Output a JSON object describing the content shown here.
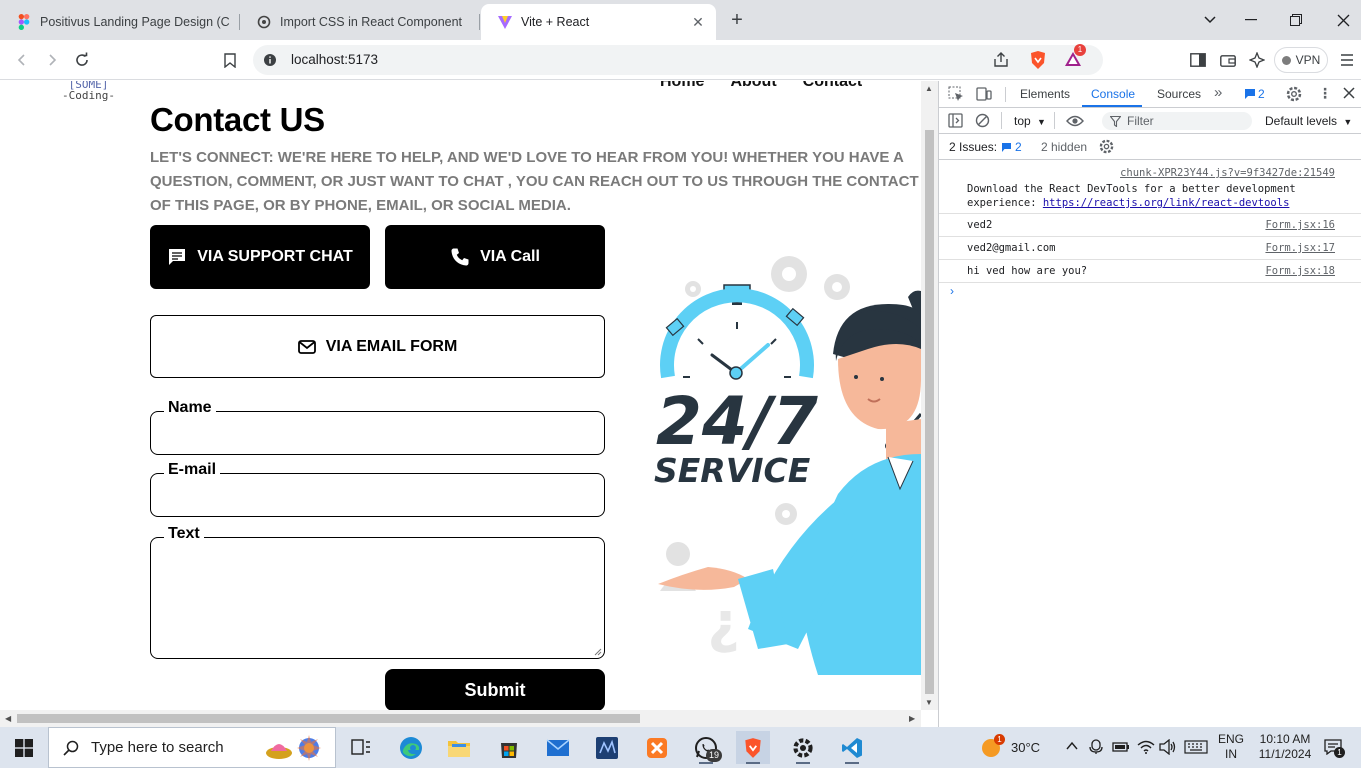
{
  "browser": {
    "tabs": [
      {
        "title": "Positivus Landing Page Design (Com",
        "icon": "figma-icon",
        "active": false
      },
      {
        "title": "Import CSS in React Component",
        "icon": "openai-icon",
        "active": false
      },
      {
        "title": "Vite + React",
        "icon": "vite-icon",
        "active": true
      }
    ],
    "url": "localhost:5173",
    "vpn_label": "VPN",
    "brave_badge": "1"
  },
  "page": {
    "logo_lines": [
      "[SOME]",
      "-Coding-"
    ],
    "nav": [
      "Home",
      "About",
      "Contact"
    ],
    "title": "Contact US",
    "subtitle": "LET'S CONNECT: WE'RE HERE TO HELP, AND WE'D LOVE TO HEAR FROM YOU! WHETHER YOU HAVE A QUESTION, COMMENT, OR JUST WANT TO CHAT , YOU CAN REACH OUT TO US THROUGH THE CONTACT FORM OF THIS PAGE, OR BY PHONE, EMAIL, OR SOCIAL MEDIA.",
    "buttons": {
      "support_chat": "VIA SUPPORT CHAT",
      "call": "VIA Call",
      "email_form": "VIA EMAIL FORM",
      "submit": "Submit"
    },
    "form": {
      "name_label": "Name",
      "email_label": "E-mail",
      "text_label": "Text"
    },
    "illustration": {
      "line1": "24/7",
      "line2": "SERVICE"
    }
  },
  "devtools": {
    "tabs": [
      "Elements",
      "Console",
      "Sources"
    ],
    "active_tab": "Console",
    "message_badge": "2",
    "context": "top",
    "filter_placeholder": "Filter",
    "levels": "Default levels",
    "issues_label": "2 Issues:",
    "issues_count": "2",
    "hidden_label": "2 hidden",
    "messages": [
      {
        "source": "chunk-XPR23Y44.js?v=9f3427de:21549",
        "text": "Download the React DevTools for a better development experience: ",
        "link": "https://reactjs.org/link/react-devtools"
      },
      {
        "source": "Form.jsx:16",
        "text": "ved2"
      },
      {
        "source": "Form.jsx:17",
        "text": "ved2@gmail.com"
      },
      {
        "source": "Form.jsx:18",
        "text": "hi ved how are you?"
      }
    ],
    "prompt": "›"
  },
  "taskbar": {
    "search_placeholder": "Type here to search",
    "weather": "30°C",
    "weather_badge": "1",
    "whatsapp_badge": "19",
    "lang": "ENG",
    "region": "IN",
    "time": "10:10 AM",
    "date": "11/1/2024",
    "notification_count": "1"
  },
  "colors": {
    "accent": "#1a73e8",
    "illustration_blue": "#5dd0f5",
    "illustration_dark": "#283540",
    "skin": "#f6b89a"
  }
}
